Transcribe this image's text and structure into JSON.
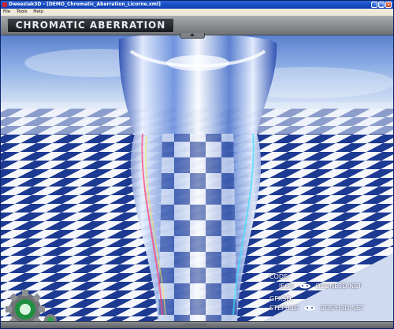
{
  "window": {
    "title": "Dweeziak3D - [DEMO_Chromatic_Aberration_Licorne.xml]",
    "controls": {
      "minimize": "_",
      "maximize": "□",
      "close": "×"
    }
  },
  "menu": {
    "items": [
      "File",
      "Tools",
      "Help"
    ]
  },
  "overlay": {
    "demo_title": "CHROMATIC ABERRATION"
  },
  "credits": {
    "code_label": "CODE:",
    "code_author": "JEGX",
    "code_site": "OZONE3D.NET",
    "gfx_label": "GFX3D:",
    "gfx_author": "STEPH3D",
    "gfx_site": "STEPH3D.NET"
  },
  "colors": {
    "accent": "#1f3f9a",
    "sky": "#4f79c9",
    "titlebar": "#0b3bb0"
  },
  "icons": {
    "logo": "gear-logo-icon"
  }
}
